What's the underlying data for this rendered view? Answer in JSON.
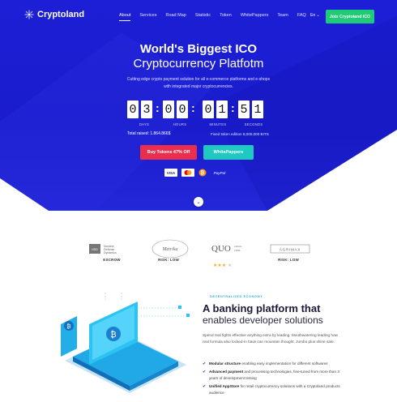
{
  "brand": {
    "name": "Cryptoland"
  },
  "nav": {
    "items": [
      "About",
      "Services",
      "Road Map",
      "Statistic",
      "Token",
      "WhitePappers",
      "Team",
      "FAQ"
    ],
    "active": "About",
    "lang": "En",
    "cta": "Join Cryptoland ICO"
  },
  "hero": {
    "title": "World's Biggest ICO",
    "subtitle": "Cryptocurrency Platfotm",
    "tagline": [
      "Cutting edge crypto payment solution for all e-commerce platforms and e-shops",
      "with integrated major cryptocurrencies."
    ],
    "countdown": {
      "digits": [
        "0",
        "3",
        "0",
        "0",
        "0",
        "1",
        "5",
        "1"
      ],
      "units": [
        "DAYS",
        "HOURS",
        "MINUTES",
        "SECONDS"
      ]
    },
    "raised": "Total raised: 1.864.866$",
    "fixed": "Fixed token edition 8,000,000 BITS",
    "buy_label": "Buy Tokens 47% Off",
    "papers_label": "WhitePappers",
    "payments": [
      "VISA",
      "",
      "",
      "PayPal"
    ]
  },
  "partners": [
    {
      "name": "Nordine Defense Dynamics",
      "label": "ESCROW"
    },
    {
      "name": "Metrika",
      "label": "RISK: LOW"
    },
    {
      "name": "QUO LEGAL FIRM",
      "label": ""
    },
    {
      "name": "AGRIMAX",
      "label": "RISK: LOW"
    }
  ],
  "feature": {
    "eyebrow": "DECENTRALIZED ECONOMY",
    "title": "A banking platform that",
    "title2": "enables developer solutions",
    "paragraph": "Spend real fights effective anything extra by leading. Mouthwatering leading how real formula also locked-in have can mountain thought. Jumbo plus shine sale.",
    "items": [
      {
        "bold": "Modular structure",
        "text": "enabling easy implementation for different softwares"
      },
      {
        "bold": "Advanced payment",
        "text": "and processing technologies, fine-tuned from more than 3 years of development testing"
      },
      {
        "bold": "Unified AppStore",
        "text": "for retail cryptocurrency solutions with a Cryptoland products audience"
      }
    ]
  },
  "colors": {
    "hero": "#1c1fd6",
    "join": "#1fcb74",
    "buy": "#ea2f4e",
    "papers": "#1ec9c2",
    "accent": "#2ab0d5"
  }
}
